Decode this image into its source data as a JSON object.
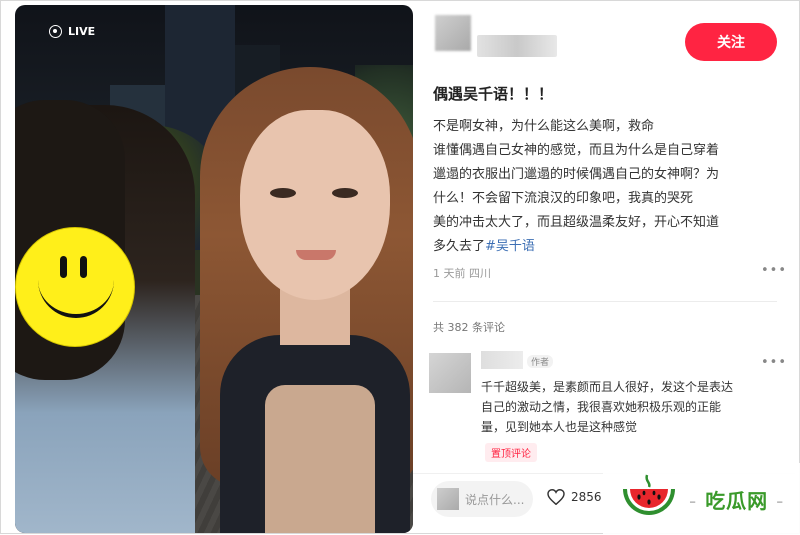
{
  "photo": {
    "live_label": "LIVE"
  },
  "author": {
    "follow_label": "关注"
  },
  "post": {
    "title": "偶遇吴千语！！！",
    "body_lines": [
      "不是啊女神，为什么能这么美啊，救命",
      "谁懂偶遇自己女神的感觉，而且为什么是自己穿着",
      "邋遢的衣服出门邋遢的时候偶遇自己的女神啊？为",
      "什么！不会留下流浪汉的印象吧，我真的哭死",
      "美的冲击太大了，而且超级温柔友好，开心不知道",
      "多久去了"
    ],
    "hashtag": "#吴千语",
    "meta": "1 天前 四川"
  },
  "comments": {
    "count_label": "共 382 条评论",
    "items": [
      {
        "author_tag": "作者",
        "body_lines": [
          "千千超级美，是素颜而且人很好，发这个是表达",
          "自己的激动之情，我很喜欢她积极乐观的正能",
          "量，见到她本人也是这种感觉"
        ],
        "pin_label": "置顶评论"
      }
    ]
  },
  "footer": {
    "input_placeholder": "说点什么...",
    "like_count": "2856"
  },
  "watermark": {
    "text": "吃瓜网",
    "dash_left": "-",
    "dash_right": "-"
  },
  "colors": {
    "accent": "#ff2442",
    "hashtag": "#3d6fb4",
    "watermark_green": "#3a9a2a"
  }
}
